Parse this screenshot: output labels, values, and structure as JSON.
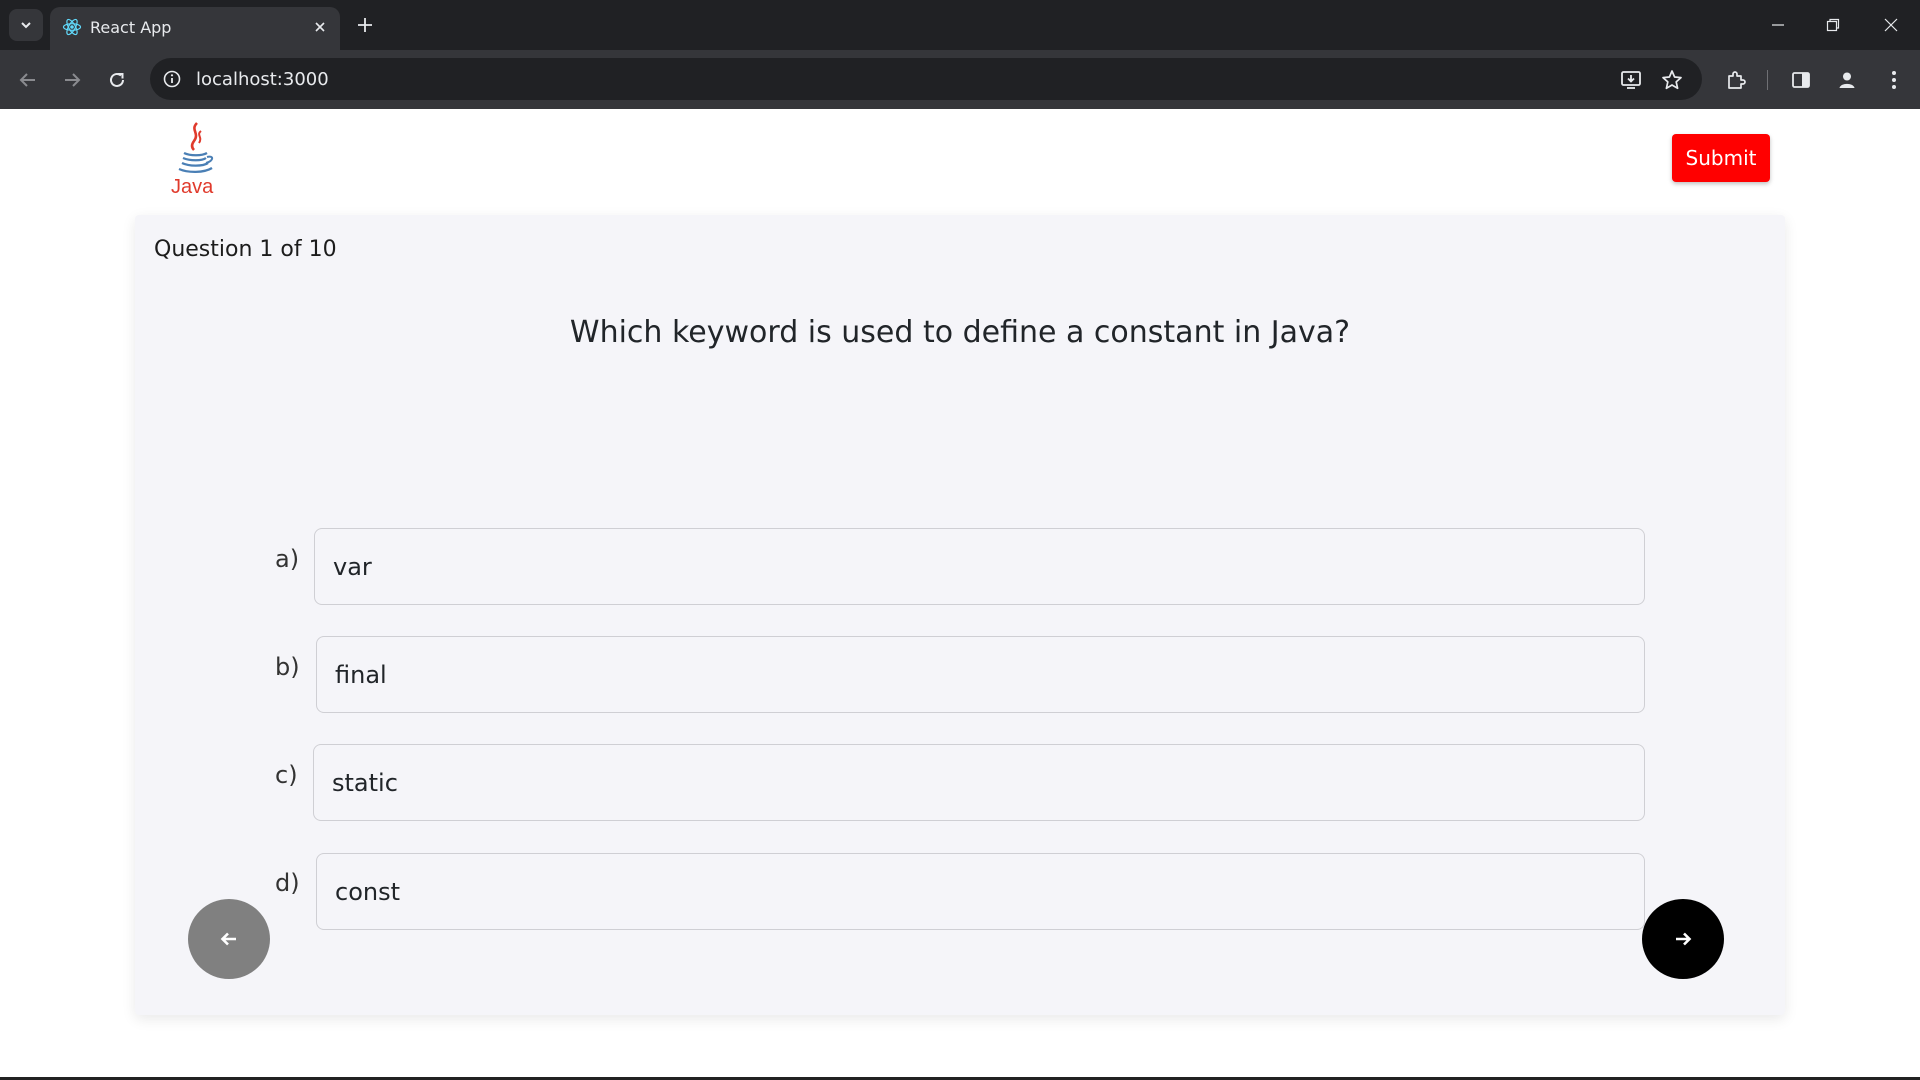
{
  "browser": {
    "tab_title": "React App",
    "url": "localhost:3000"
  },
  "header": {
    "logo_text": "Java",
    "submit_label": "Submit"
  },
  "quiz": {
    "counter": "Question 1 of 10",
    "question": "Which keyword is used to define a constant in Java?",
    "options": [
      {
        "letter": "a)",
        "text": "var"
      },
      {
        "letter": "b)",
        "text": "final"
      },
      {
        "letter": "c)",
        "text": "static"
      },
      {
        "letter": "d)",
        "text": "const"
      }
    ]
  },
  "icons": {
    "prev": "arrow-left-icon",
    "next": "arrow-right-icon"
  },
  "colors": {
    "submit": "#ff0000",
    "prev_button": "#808080",
    "next_button": "#000000"
  }
}
